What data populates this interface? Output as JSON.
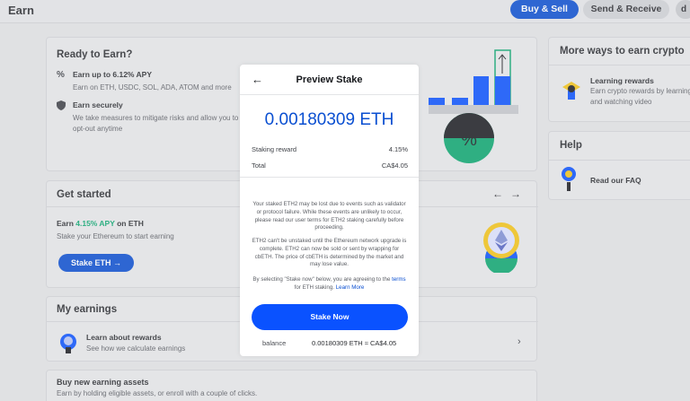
{
  "header": {
    "title": "Earn",
    "buy_sell": "Buy & Sell",
    "send_receive": "Send & Receive",
    "avatar_initial": "d"
  },
  "ready": {
    "title": "Ready to Earn?",
    "items": [
      {
        "icon": "%",
        "title": "Earn up to 6.12% APY",
        "desc": "Earn on ETH, USDC, SOL, ADA, ATOM and more"
      },
      {
        "icon": "shield",
        "title": "Earn securely",
        "desc": "We take measures to mitigate risks and allow you to opt-out anytime"
      }
    ]
  },
  "started": {
    "title": "Get started",
    "earn_prefix": "Earn ",
    "earn_apy": "4.15% APY",
    "earn_suffix": " on ETH",
    "desc": "Stake your Ethereum to start earning",
    "button": "Stake ETH →"
  },
  "earnings": {
    "title": "My earnings",
    "learn_title": "Learn about rewards",
    "learn_desc": "See how we calculate earnings"
  },
  "buy": {
    "title": "Buy new earning assets",
    "desc": "Earn by holding eligible assets, or enroll with a couple of clicks."
  },
  "more": {
    "title": "More ways to earn crypto",
    "item_title": "Learning rewards",
    "item_desc": "Earn crypto rewards by learning and watching video"
  },
  "help": {
    "title": "Help",
    "item_title": "Read our FAQ"
  },
  "modal": {
    "title": "Preview Stake",
    "amount": "0.00180309 ETH",
    "reward_label": "Staking reward",
    "reward_value": "4.15%",
    "total_label": "Total",
    "total_value": "CA$4.05",
    "disc1": "Your staked ETH2 may be lost due to events such as validator or protocol failure. While these events are unlikely to occur, please read our user terms for ETH2 staking carefully before proceeding.",
    "disc2": "ETH2 can't be unstaked until the Ethereum network upgrade is complete. ETH2 can now be sold or sent by wrapping for cbETH. The price of cbETH is determined by the market and may lose value.",
    "disc3_a": "By selecting \"Stake now\" below, you are agreeing to the ",
    "disc3_link1": "terms",
    "disc3_b": " for ETH staking. ",
    "disc3_link2": "Learn More",
    "button": "Stake Now",
    "balance_label": "balance",
    "balance_value": "0.00180309 ETH ≈ CA$4.05"
  },
  "colors": {
    "brand_blue": "#0a52ff",
    "green": "#0ba870",
    "yellow": "#f5c518"
  }
}
